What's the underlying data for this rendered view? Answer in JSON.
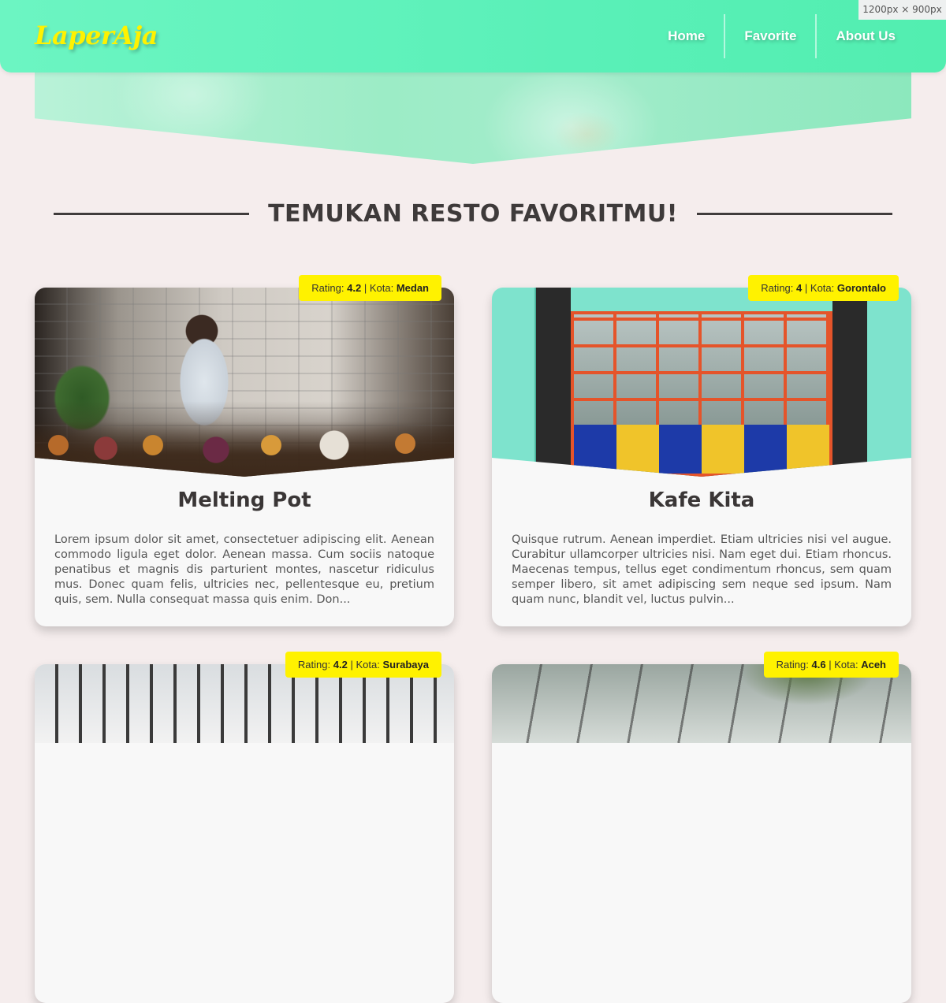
{
  "app": {
    "brand": "LaperAja",
    "size_indicator": "1200px × 900px"
  },
  "nav": {
    "items": [
      {
        "label": "Home"
      },
      {
        "label": "Favorite"
      },
      {
        "label": "About Us"
      }
    ]
  },
  "section": {
    "title": "TEMUKAN RESTO FAVORITMU!"
  },
  "badge_labels": {
    "rating": "Rating:",
    "separator": "|",
    "kota": "Kota:"
  },
  "restaurants": [
    {
      "name": "Melting Pot",
      "rating": "4.2",
      "city": "Medan",
      "description": "Lorem ipsum dolor sit amet, consectetuer adipiscing elit. Aenean commodo ligula eget dolor. Aenean massa. Cum sociis natoque penatibus et magnis dis parturient montes, nascetur ridiculus mus. Donec quam felis, ultricies nec, pellentesque eu, pretium quis, sem. Nulla consequat massa quis enim. Don..."
    },
    {
      "name": "Kafe Kita",
      "rating": "4",
      "city": "Gorontalo",
      "description": "Quisque rutrum. Aenean imperdiet. Etiam ultricies nisi vel augue. Curabitur ullamcorper ultricies nisi. Nam eget dui. Etiam rhoncus. Maecenas tempus, tellus eget condimentum rhoncus, sem quam semper libero, sit amet adipiscing sem neque sed ipsum. Nam quam nunc, blandit vel, luctus pulvin..."
    },
    {
      "name": "",
      "rating": "4.2",
      "city": "Surabaya",
      "description": ""
    },
    {
      "name": "",
      "rating": "4.6",
      "city": "Aceh",
      "description": ""
    }
  ],
  "colors": {
    "navbar": "#5af0b8",
    "brand": "#fff200",
    "badge": "#fff200",
    "background": "#f5eded",
    "title_text": "#3e3a3a"
  }
}
